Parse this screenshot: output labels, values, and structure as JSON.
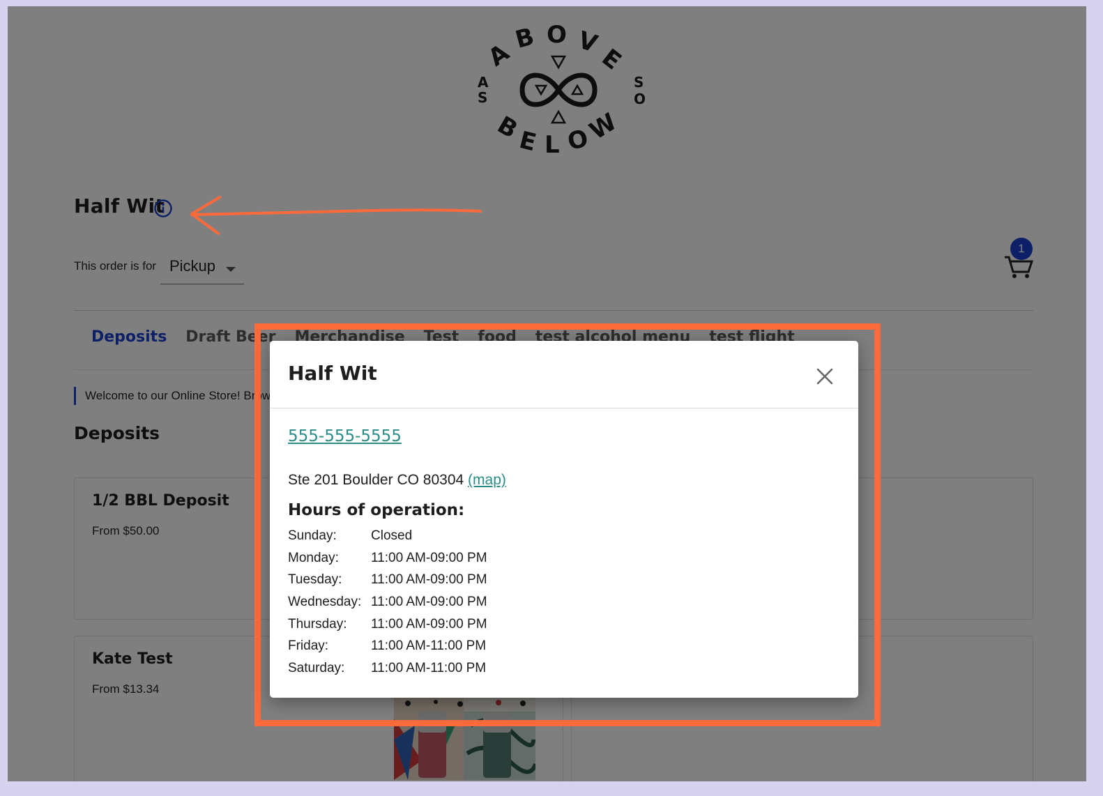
{
  "logo": {
    "top_letters": [
      "A",
      "B",
      "O",
      "V",
      "E"
    ],
    "left_letters": [
      "A",
      "S"
    ],
    "right_letters": [
      "S",
      "O"
    ],
    "bottom_letters": [
      "B",
      "E",
      "L",
      "O",
      "W"
    ]
  },
  "store": {
    "name": "Half Wit",
    "info_icon": "info-icon"
  },
  "order": {
    "label": "This order is for",
    "type": "Pickup"
  },
  "cart": {
    "icon": "cart-icon",
    "count": "1"
  },
  "tabs": [
    {
      "label": "Deposits"
    },
    {
      "label": "Draft Beer"
    },
    {
      "label": "Merchandise"
    },
    {
      "label": "Test"
    },
    {
      "label": "food"
    },
    {
      "label": "test alcohol menu"
    },
    {
      "label": "test flight"
    }
  ],
  "welcome": "Welcome to our Online Store! Brow",
  "section": {
    "title": "Deposits"
  },
  "cards": [
    {
      "name": "1/2 BBL Deposit",
      "price": "From $50.00"
    },
    {
      "name": "Kate Test",
      "price": "From $13.34"
    }
  ],
  "modal": {
    "title": "Half Wit",
    "close_icon": "close-icon",
    "phone": "555-555-5555",
    "address": "Ste 201 Boulder CO 80304",
    "map_label": "(map)",
    "hours_title": "Hours of operation:",
    "hours": [
      {
        "day": "Sunday:",
        "time": "Closed"
      },
      {
        "day": "Monday:",
        "time": "11:00 AM-09:00 PM"
      },
      {
        "day": "Tuesday:",
        "time": "11:00 AM-09:00 PM"
      },
      {
        "day": "Wednesday:",
        "time": "11:00 AM-09:00 PM"
      },
      {
        "day": "Thursday:",
        "time": "11:00 AM-09:00 PM"
      },
      {
        "day": "Friday:",
        "time": "11:00 AM-11:00 PM"
      },
      {
        "day": "Saturday:",
        "time": "11:00 AM-11:00 PM"
      }
    ]
  },
  "colors": {
    "accent_blue": "#1a3fcc",
    "link_teal": "#2a8c86",
    "annotation_orange": "#ff6a3a",
    "page_border": "#d6d2ef"
  }
}
